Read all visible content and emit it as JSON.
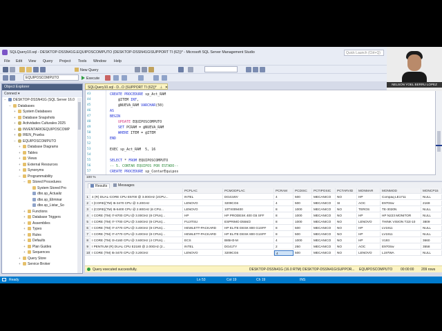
{
  "window": {
    "title": "SQLQuery10.sql - DESKTOP-DSSN41G.EQUIPOSCOMPUTO (DESKTOP-DSSN41G\\SUPPORT TI (62))* - Microsoft SQL Server Management Studio",
    "quick_launch_placeholder": "Quick Launch (Ctrl+Q)"
  },
  "menu": [
    "File",
    "Edit",
    "View",
    "Query",
    "Project",
    "Tools",
    "Window",
    "Help"
  ],
  "toolbar": {
    "new_query": "New Query",
    "database": "EQUIPOSCOMPUTO",
    "execute": "Execute"
  },
  "object_explorer": {
    "title": "Object Explorer",
    "connect": "Connect ▾",
    "nodes": [
      {
        "label": "DESKTOP-DSSN41G (SQL Server 16.0",
        "level": 0,
        "icon": "server-icon"
      },
      {
        "label": "Databases",
        "level": 1,
        "icon": "folder-icon"
      },
      {
        "label": "System Databases",
        "level": 2,
        "icon": "folder-icon"
      },
      {
        "label": "Database Snapshots",
        "level": 2,
        "icon": "folder-icon"
      },
      {
        "label": "Actividades Culturales 2025",
        "level": 2,
        "icon": "database-icon"
      },
      {
        "label": "INVENTARIOEQUIPOSCOMP",
        "level": 2,
        "icon": "database-icon"
      },
      {
        "label": "IREN_Prueba",
        "level": 2,
        "icon": "database-icon"
      },
      {
        "label": "EQUIPOSCOMPUTO",
        "level": 2,
        "icon": "database-icon"
      },
      {
        "label": "Database Diagrams",
        "level": 3,
        "icon": "folder-icon"
      },
      {
        "label": "Tables",
        "level": 3,
        "icon": "folder-icon"
      },
      {
        "label": "Views",
        "level": 3,
        "icon": "folder-icon"
      },
      {
        "label": "External Resources",
        "level": 3,
        "icon": "folder-icon"
      },
      {
        "label": "Synonyms",
        "level": 3,
        "icon": "folder-icon"
      },
      {
        "label": "Programmability",
        "level": 3,
        "icon": "folder-icon"
      },
      {
        "label": "Stored Procedures",
        "level": 4,
        "icon": "folder-icon"
      },
      {
        "label": "System Stored Pro",
        "level": 5,
        "icon": "folder-icon"
      },
      {
        "label": "dbo.sp_Actualiz",
        "level": 5,
        "icon": "stored-procedure-icon"
      },
      {
        "label": "dbo.sp_Eliminar",
        "level": 5,
        "icon": "stored-procedure-icon"
      },
      {
        "label": "dbo.sp_Listar_So",
        "level": 5,
        "icon": "stored-procedure-icon"
      },
      {
        "label": "Functions",
        "level": 4,
        "icon": "folder-icon"
      },
      {
        "label": "Database Triggers",
        "level": 4,
        "icon": "folder-icon"
      },
      {
        "label": "Assemblies",
        "level": 4,
        "icon": "folder-icon"
      },
      {
        "label": "Types",
        "level": 4,
        "icon": "folder-icon"
      },
      {
        "label": "Rules",
        "level": 4,
        "icon": "folder-icon"
      },
      {
        "label": "Defaults",
        "level": 4,
        "icon": "folder-icon"
      },
      {
        "label": "Plan Guides",
        "level": 4,
        "icon": "folder-icon"
      },
      {
        "label": "Sequences",
        "level": 4,
        "icon": "folder-icon"
      },
      {
        "label": "Query Store",
        "level": 3,
        "icon": "folder-icon"
      },
      {
        "label": "Service Broker",
        "level": 3,
        "icon": "folder-icon"
      }
    ]
  },
  "editor": {
    "tab_label": "SQLQuery10.sql - D...O (SUPPORT TI (62))*",
    "line_numbers": [
      "43",
      "44",
      "45",
      "46",
      "47",
      "48",
      "49",
      "50",
      "51",
      "52",
      "53",
      "54",
      "55",
      "56",
      "57",
      "58",
      "59",
      "60"
    ],
    "zoom": "100 %"
  },
  "results": {
    "tab_results": "Results",
    "tab_messages": "Messages",
    "columns": [
      "",
      "PCPLAC",
      "PCMODPLAC",
      "PCRAM",
      "PCDISC",
      "PCTIPOSIC",
      "PCTARVID",
      "MONMAR",
      "MONMOD",
      "MONCP15"
    ],
    "rows": [
      [
        "1",
        "4 (R) DUAL-CORE CPU E5700 @ 3.00GHz (2CPU...",
        "INTEL",
        "DG41WV",
        "4",
        "500",
        "MECANICO",
        "NO",
        "HP",
        "Compaq LE1711",
        "NULL"
      ],
      [
        "2",
        "I (CORE)(TM) I5-3470 CPU @ 3.20GHz",
        "LENOVO",
        "3209CG6",
        "4",
        "500",
        "MECANICO",
        "SI",
        "AOC",
        "E970Sw",
        "2169"
      ],
      [
        "3",
        "I (CORE)(TM) I5-5400 CPU @ 2.80GHz (6 CPU...",
        "LENOVO",
        "10TX009400",
        "8",
        "1000",
        "MECANICO",
        "NO",
        "TEROS",
        "TE-3020N",
        "NULL"
      ],
      [
        "4",
        "I CORE (TM) I7-8700 CPU @ 3.00GHz (8 CPUs)...",
        "HP",
        "HP PRODESK 400 G5 SFF",
        "8",
        "1000",
        "MECANICO",
        "NO",
        "HP",
        "HP N223 MONITOR",
        "NULL"
      ],
      [
        "5",
        "I CORE (TM) I7-7700 CPU @ 3.60GHz (8 CPUs)...",
        "FUJITSU",
        "ESPRIMO D556/2",
        "8",
        "1000",
        "MECANICO",
        "NO",
        "LENOVO",
        "THINK VISION T22i-10",
        "3809"
      ],
      [
        "6",
        "I CORE (TM) I7-4770 CPU @ 3.40GHz (8 CPUs)...",
        "HEWLETT-PACKARD",
        "HP ELITE DESK 800 G1SFF",
        "8",
        "500",
        "MECANICO",
        "NO",
        "HP",
        "LV1911",
        "NULL"
      ],
      [
        "7",
        "I CORE (TM) I7-4770 CPU @ 3.40GHz (8 CPUs)...",
        "HEWLETT-PACKARD",
        "HP ELITE DESK 800 G1SFF",
        "8",
        "500",
        "MECANICO",
        "NO",
        "HP",
        "LV1911",
        "NULL"
      ],
      [
        "8",
        "I CORE (TM) I3-4160 CPU @ 3.60GHz (4 CPUs)...",
        "ECS",
        "B85H3-M",
        "4",
        "1000",
        "MECANICO",
        "NO",
        "HP",
        "V193",
        "3660"
      ],
      [
        "9",
        "I PENTIUM (R) DUAL CPU E2180 @ 2.00GHz (2...",
        "INTEL",
        "DG41TY",
        "2",
        "250",
        "MECANICO",
        "NO",
        "AOC",
        "E970Sw",
        "3558"
      ],
      [
        "10",
        "I CORE (TM) I5-3470 CPU @ 3.20GHz",
        "LENOVO",
        "3209CG6",
        "4",
        "500",
        "MECANICO",
        "NO",
        "LENOVO",
        "L197WA",
        "NULL"
      ]
    ],
    "status": "Query executed successfully.",
    "server": "DESKTOP-DSSN41G (16.0 RTM)",
    "user": "DESKTOP-DSSN41G\\SUPPOR...",
    "db": "EQUIPOSCOMPUTO",
    "time": "00:00:00",
    "rows_count": "209 rows"
  },
  "statusbar": {
    "ready": "Ready",
    "ln": "Ln 53",
    "col": "Col 19",
    "ch": "Ch 19",
    "ins": "INS"
  },
  "webcam": {
    "name": "NELSON YOEL BERRU LOPEZ"
  },
  "colors": {
    "statusbar": "#007acc",
    "editor_tab": "#fbf4c3",
    "oe_header": "#4d6082"
  }
}
